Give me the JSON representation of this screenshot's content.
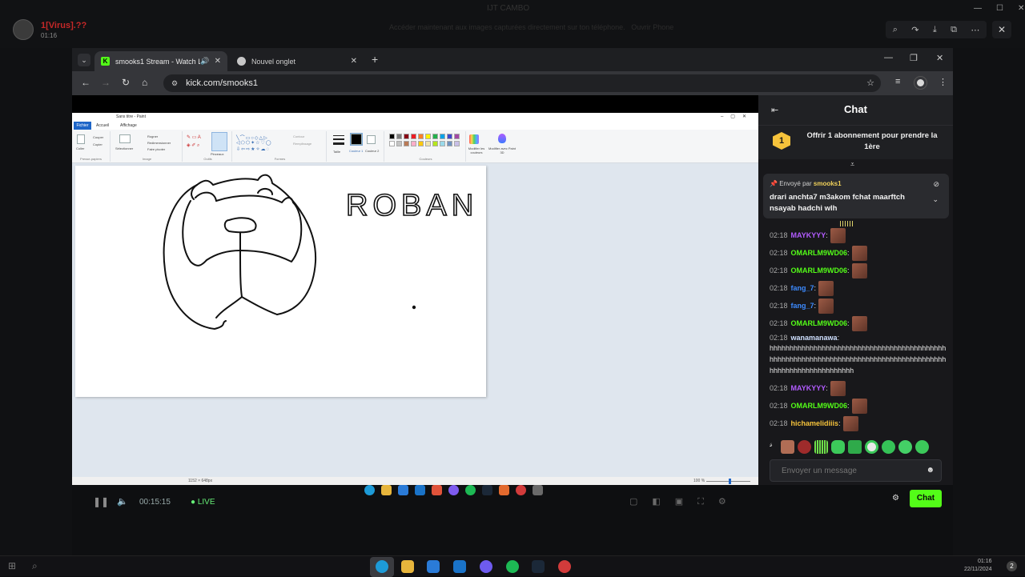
{
  "viewer": {
    "username": "1[Virus].??",
    "time": "01:16",
    "title": "IJT CAMBO",
    "message": "Accéder maintenant aux images capturées directement sur ton téléphone.",
    "message_action": "Ouvrir Phone",
    "tools": [
      "zoom-icon",
      "share-icon",
      "download-icon",
      "open-external-icon",
      "more-icon"
    ],
    "close": "✕"
  },
  "browser": {
    "tabs": [
      {
        "title": "smooks1 Stream - Watch Li",
        "icon": "kick-icon",
        "active": true,
        "audio": "🔊"
      },
      {
        "title": "Nouvel onglet",
        "icon": "chrome-icon",
        "active": false
      }
    ],
    "new_tab": "+",
    "url": "kick.com/smooks1",
    "window_controls": {
      "minimize": "—",
      "maximize": "❐",
      "close": "✕"
    }
  },
  "paint": {
    "window_title": "Sans titre - Paint",
    "menu_tabs": [
      "Fichier",
      "Accueil",
      "Affichage"
    ],
    "groups": [
      "Presse-papiers",
      "Image",
      "Outils",
      "Formes",
      "Couleurs"
    ],
    "labels": {
      "coller": "Coller",
      "couper": "Couper",
      "copier": "Copier",
      "selectionner": "Sélectionner",
      "rogner": "Rogner",
      "redimensionner": "Redimensionner",
      "faire_pivoter": "Faire pivoter",
      "pinceaux": "Pinceaux",
      "contour": "Contour",
      "remplissage": "Remplissage",
      "taille": "Taille",
      "couleur1": "Couleur 1",
      "couleur2": "Couleur 2",
      "modifier_couleurs": "Modifier les couleurs",
      "paint3d": "Modifier avec Paint 3D"
    },
    "canvas_text": "ROBAN",
    "status_dims": "1152 × 648px",
    "zoom": "100 %",
    "palette": [
      "#000000",
      "#7f7f7f",
      "#880015",
      "#ed1c24",
      "#ff7f27",
      "#fff200",
      "#22b14c",
      "#00a2e8",
      "#3f48cc",
      "#a349a4",
      "#ffffff",
      "#c3c3c3",
      "#b97a57",
      "#ffaec9",
      "#ffc90e",
      "#efe4b0",
      "#b5e61d",
      "#99d9ea",
      "#7092be",
      "#c8bfe7"
    ]
  },
  "stream": {
    "time": "00:15:15",
    "live": "LIVE"
  },
  "chat": {
    "title": "Chat",
    "gift_badge": "1",
    "gift_text": "Offrir 1 abonnement pour prendre la 1ère",
    "pinned": {
      "prefix": "Envoyé par",
      "user": "smooks1",
      "text": "drari anchta7 m3akom fchat maarftch nsayab hadchi wlh"
    },
    "messages": [
      {
        "time": "02:18",
        "user": "MAYKYYY",
        "color": "#b25cff",
        "text": "",
        "emote": true
      },
      {
        "time": "02:18",
        "user": "OMARLM9WD06",
        "color": "#53fc18",
        "text": "",
        "emote": true
      },
      {
        "time": "02:18",
        "user": "OMARLM9WD06",
        "color": "#53fc18",
        "text": "",
        "emote": true
      },
      {
        "time": "02:18",
        "user": "fang_7",
        "color": "#3d8bff",
        "text": "",
        "emote": true
      },
      {
        "time": "02:18",
        "user": "fang_7",
        "color": "#3d8bff",
        "text": "",
        "emote": true
      },
      {
        "time": "02:18",
        "user": "OMARLM9WD06",
        "color": "#53fc18",
        "text": "",
        "emote": true
      },
      {
        "time": "02:18",
        "user": "wanamanawa",
        "color": "#cfe0ff",
        "text": "hhhhhhhhhhhhhhhhhhhhhhhhhhhhhhhhhhhhhhhhhhhhhhhhhhhhhhhhhhhhhhhhhhhhhhhhhhhhhhhhhhhhhhhhhhhhhhhhhhhhhhhhhhhhh",
        "emote": false
      },
      {
        "time": "02:18",
        "user": "MAYKYYY",
        "color": "#b25cff",
        "text": "",
        "emote": true
      },
      {
        "time": "02:18",
        "user": "OMARLM9WD06",
        "color": "#53fc18",
        "text": "",
        "emote": true
      },
      {
        "time": "02:18",
        "user": "hichamelidiiis",
        "color": "#f6c33b",
        "text": "",
        "emote": true
      }
    ],
    "input_placeholder": "Envoyer un message",
    "send_label": "Chat"
  },
  "taskbar": {
    "clock_time": "01:16",
    "clock_date": "22/11/2024",
    "notif_count": "2"
  },
  "colors": {
    "kick_green": "#53fc18",
    "chat_bg": "#18181b",
    "browser_bg": "#202124"
  }
}
